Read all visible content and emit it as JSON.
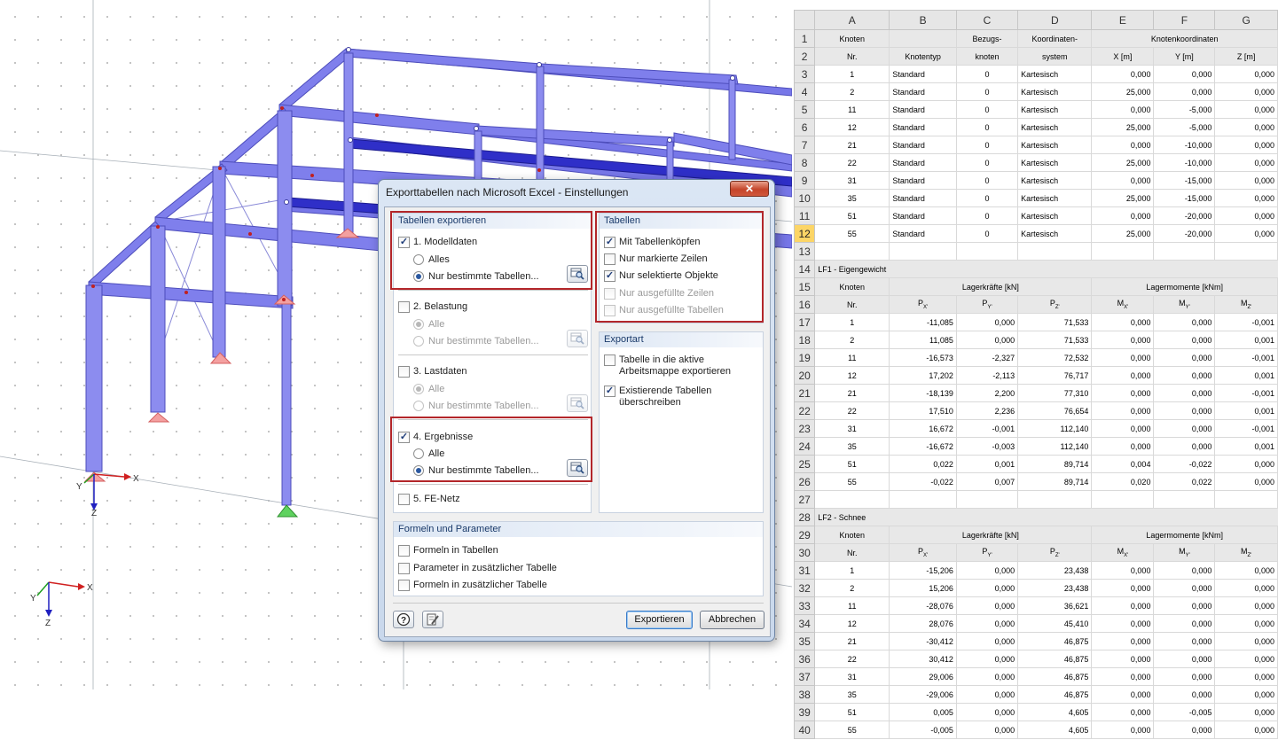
{
  "view3d": {
    "axes_main": {
      "x": "X",
      "y": "Y",
      "z": "Z"
    },
    "axes_corner": {
      "x": "X",
      "y": "Y",
      "z": "Z"
    }
  },
  "dialog": {
    "title": "Exporttabellen nach Microsoft Excel - Einstellungen",
    "close_label": "✕",
    "tabellen_exportieren": {
      "heading": "Tabellen exportieren",
      "modelldaten": {
        "label": "1. Modelldaten",
        "checked": true
      },
      "modelldaten_alles": {
        "label": "Alles",
        "selected": false
      },
      "modelldaten_bestimmte": {
        "label": "Nur bestimmte Tabellen...",
        "selected": true
      },
      "belastung": {
        "label": "2. Belastung",
        "checked": false
      },
      "belastung_alle": {
        "label": "Alle",
        "selected": true
      },
      "belastung_bestimmte": {
        "label": "Nur bestimmte Tabellen...",
        "selected": false
      },
      "lastdaten": {
        "label": "3. Lastdaten",
        "checked": false
      },
      "lastdaten_alle": {
        "label": "Alle",
        "selected": true
      },
      "lastdaten_bestimmte": {
        "label": "Nur bestimmte Tabellen...",
        "selected": false
      },
      "ergebnisse": {
        "label": "4. Ergebnisse",
        "checked": true
      },
      "ergebnisse_alle": {
        "label": "Alle",
        "selected": false
      },
      "ergebnisse_bestimmte": {
        "label": "Nur bestimmte Tabellen...",
        "selected": true
      },
      "fe_netz": {
        "label": "5. FE-Netz",
        "checked": false
      }
    },
    "tabellen": {
      "heading": "Tabellen",
      "items": [
        {
          "label": "Mit Tabellenköpfen",
          "checked": true
        },
        {
          "label": "Nur markierte Zeilen",
          "checked": false
        },
        {
          "label": "Nur selektierte Objekte",
          "checked": true
        },
        {
          "label": "Nur ausgefüllte Zeilen",
          "checked": false
        },
        {
          "label": "Nur ausgefüllte Tabellen",
          "checked": false
        }
      ]
    },
    "exportart": {
      "heading": "Exportart",
      "aktive_line1": "Tabelle in die aktive",
      "aktive_line2": "Arbeitsmappe exportieren",
      "aktive_checked": false,
      "existierende_line1": "Existierende Tabellen",
      "existierende_line2": "überschreiben",
      "existierende_checked": true
    },
    "formeln": {
      "heading": "Formeln und Parameter",
      "items": [
        {
          "label": "Formeln in Tabellen",
          "checked": false
        },
        {
          "label": "Parameter in zusätzlicher Tabelle",
          "checked": false
        },
        {
          "label": "Formeln in zusätzlicher Tabelle",
          "checked": false
        }
      ]
    },
    "help_label": "?",
    "export_label": "Exportieren",
    "cancel_label": "Abbrechen"
  },
  "sheet": {
    "columns": [
      "A",
      "B",
      "C",
      "D",
      "E",
      "F",
      "G"
    ],
    "selected_row": "12",
    "nodes": {
      "h1": [
        "Knoten",
        "",
        "Bezugs-",
        "Koordinaten-",
        "Knotenkoordinaten"
      ],
      "h2": [
        "Nr.",
        "Knotentyp",
        "knoten",
        "system",
        "X [m]",
        "Y [m]",
        "Z [m]"
      ],
      "rows": [
        [
          "1",
          "Standard",
          "0",
          "Kartesisch",
          "0,000",
          "0,000",
          "0,000"
        ],
        [
          "2",
          "Standard",
          "0",
          "Kartesisch",
          "25,000",
          "0,000",
          "0,000"
        ],
        [
          "11",
          "Standard",
          "0",
          "Kartesisch",
          "0,000",
          "-5,000",
          "0,000"
        ],
        [
          "12",
          "Standard",
          "0",
          "Kartesisch",
          "25,000",
          "-5,000",
          "0,000"
        ],
        [
          "21",
          "Standard",
          "0",
          "Kartesisch",
          "0,000",
          "-10,000",
          "0,000"
        ],
        [
          "22",
          "Standard",
          "0",
          "Kartesisch",
          "25,000",
          "-10,000",
          "0,000"
        ],
        [
          "31",
          "Standard",
          "0",
          "Kartesisch",
          "0,000",
          "-15,000",
          "0,000"
        ],
        [
          "35",
          "Standard",
          "0",
          "Kartesisch",
          "25,000",
          "-15,000",
          "0,000"
        ],
        [
          "51",
          "Standard",
          "0",
          "Kartesisch",
          "0,000",
          "-20,000",
          "0,000"
        ],
        [
          "55",
          "Standard",
          "0",
          "Kartesisch",
          "25,000",
          "-20,000",
          "0,000"
        ]
      ]
    },
    "lf1": {
      "title": "LF1 - Eigengewicht",
      "h1": [
        "Knoten",
        "Lagerkräfte [kN]",
        "Lagermomente [kNm]"
      ],
      "h2": [
        "Nr.",
        "P",
        "X'",
        "P",
        "Y'",
        "P",
        "Z'",
        "M",
        "X'",
        "M",
        "Y'",
        "M",
        "Z'"
      ],
      "rows": [
        [
          "1",
          "-11,085",
          "0,000",
          "71,533",
          "0,000",
          "0,000",
          "-0,001"
        ],
        [
          "2",
          "11,085",
          "0,000",
          "71,533",
          "0,000",
          "0,000",
          "0,001"
        ],
        [
          "11",
          "-16,573",
          "-2,327",
          "72,532",
          "0,000",
          "0,000",
          "-0,001"
        ],
        [
          "12",
          "17,202",
          "-2,113",
          "76,717",
          "0,000",
          "0,000",
          "0,001"
        ],
        [
          "21",
          "-18,139",
          "2,200",
          "77,310",
          "0,000",
          "0,000",
          "-0,001"
        ],
        [
          "22",
          "17,510",
          "2,236",
          "76,654",
          "0,000",
          "0,000",
          "0,001"
        ],
        [
          "31",
          "16,672",
          "-0,001",
          "112,140",
          "0,000",
          "0,000",
          "-0,001"
        ],
        [
          "35",
          "-16,672",
          "-0,003",
          "112,140",
          "0,000",
          "0,000",
          "0,001"
        ],
        [
          "51",
          "0,022",
          "0,001",
          "89,714",
          "0,004",
          "-0,022",
          "0,000"
        ],
        [
          "55",
          "-0,022",
          "0,007",
          "89,714",
          "0,020",
          "0,022",
          "0,000"
        ]
      ]
    },
    "lf2": {
      "title": "LF2 - Schnee",
      "h1": [
        "Knoten",
        "Lagerkräfte [kN]",
        "Lagermomente [kNm]"
      ],
      "h2": [
        "Nr.",
        "P",
        "X'",
        "P",
        "Y'",
        "P",
        "Z'",
        "M",
        "X'",
        "M",
        "Y'",
        "M",
        "Z'"
      ],
      "rows": [
        [
          "1",
          "-15,206",
          "0,000",
          "23,438",
          "0,000",
          "0,000",
          "0,000"
        ],
        [
          "2",
          "15,206",
          "0,000",
          "23,438",
          "0,000",
          "0,000",
          "0,000"
        ],
        [
          "11",
          "-28,076",
          "0,000",
          "36,621",
          "0,000",
          "0,000",
          "0,000"
        ],
        [
          "12",
          "28,076",
          "0,000",
          "45,410",
          "0,000",
          "0,000",
          "0,000"
        ],
        [
          "21",
          "-30,412",
          "0,000",
          "46,875",
          "0,000",
          "0,000",
          "0,000"
        ],
        [
          "22",
          "30,412",
          "0,000",
          "46,875",
          "0,000",
          "0,000",
          "0,000"
        ],
        [
          "31",
          "29,006",
          "0,000",
          "46,875",
          "0,000",
          "0,000",
          "0,000"
        ],
        [
          "35",
          "-29,006",
          "0,000",
          "46,875",
          "0,000",
          "0,000",
          "0,000"
        ],
        [
          "51",
          "0,005",
          "0,000",
          "4,605",
          "0,000",
          "-0,005",
          "0,000"
        ],
        [
          "55",
          "-0,005",
          "0,000",
          "4,605",
          "0,000",
          "0,000",
          "0,000"
        ]
      ]
    }
  }
}
